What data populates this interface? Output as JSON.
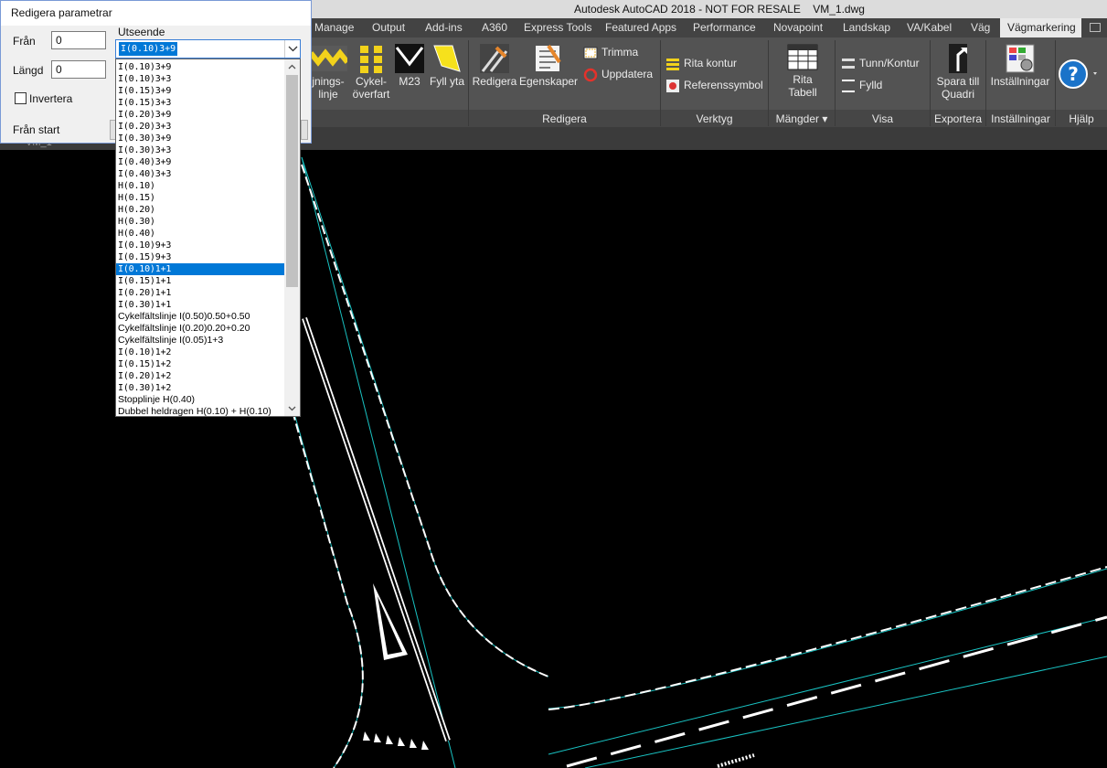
{
  "window": {
    "title": "Autodesk AutoCAD 2018 - NOT FOR RESALE    VM_1.dwg"
  },
  "ribbon_tabs": [
    "Manage",
    "Output",
    "Add-ins",
    "A360",
    "Express Tools",
    "Featured Apps",
    "Performance",
    "Novapoint",
    "Landskap",
    "VA/Kabel",
    "Väg",
    "Vägmarkering"
  ],
  "ribbon": {
    "buttons": {
      "korfalt": [
        "jnings-",
        "linje"
      ],
      "cykel": [
        "Cykel-",
        "överfart"
      ],
      "m23": "M23",
      "fyll_yta": "Fyll yta",
      "redigera": "Redigera",
      "egenskaper": "Egenskaper",
      "trimma": "Trimma",
      "uppdatera": "Uppdatera",
      "rita_kontur": "Rita kontur",
      "referenssymbol": "Referenssymbol",
      "rita_tabell": [
        "Rita",
        "Tabell"
      ],
      "tunn_kontur": "Tunn/Kontur",
      "fylld": "Fylld",
      "spara_quadri": [
        "Spara till",
        "Quadri"
      ],
      "installningar": "Inställningar"
    },
    "panels": {
      "redigera": "Redigera",
      "verktyg": "Verktyg",
      "mangder": "Mängder",
      "visa": "Visa",
      "exportera": "Exportera",
      "installningar": "Inställningar",
      "hjalp": "Hjälp"
    }
  },
  "document_tab": "VM_1",
  "dialog": {
    "title": "Redigera parametrar",
    "fran_label": "Från",
    "fran_value": "0",
    "langd_label": "Längd",
    "langd_value": "0",
    "invertera_label": "Invertera",
    "fran_start_label": "Från start",
    "utseende_label": "Utseende",
    "utseende_selected": "I(0.10)3+9",
    "utseende_options": [
      "I(0.10)3+9",
      "I(0.10)3+3",
      "I(0.15)3+9",
      "I(0.15)3+3",
      "I(0.20)3+9",
      "I(0.20)3+3",
      "I(0.30)3+9",
      "I(0.30)3+3",
      "I(0.40)3+9",
      "I(0.40)3+3",
      "H(0.10)",
      "H(0.15)",
      "H(0.20)",
      "H(0.30)",
      "H(0.40)",
      "I(0.10)9+3",
      "I(0.15)9+3",
      "I(0.10)1+1",
      "I(0.15)1+1",
      "I(0.20)1+1",
      "I(0.30)1+1",
      "Cykelfältslinje I(0.50)0.50+0.50",
      "Cykelfältslinje I(0.20)0.20+0.20",
      "Cykelfältslinje I(0.05)1+3",
      "I(0.10)1+2",
      "I(0.15)1+2",
      "I(0.20)1+2",
      "I(0.30)1+2",
      "Stopplinje H(0.40)",
      "Dubbel heldragen H(0.10) + H(0.10)"
    ],
    "highlighted_index": 17
  },
  "colors": {
    "ribbon_bg": "#535353",
    "selection": "#0078d7",
    "road_line": "#ffffff",
    "guide_line": "#19c3c3",
    "canvas_bg": "#000000"
  }
}
